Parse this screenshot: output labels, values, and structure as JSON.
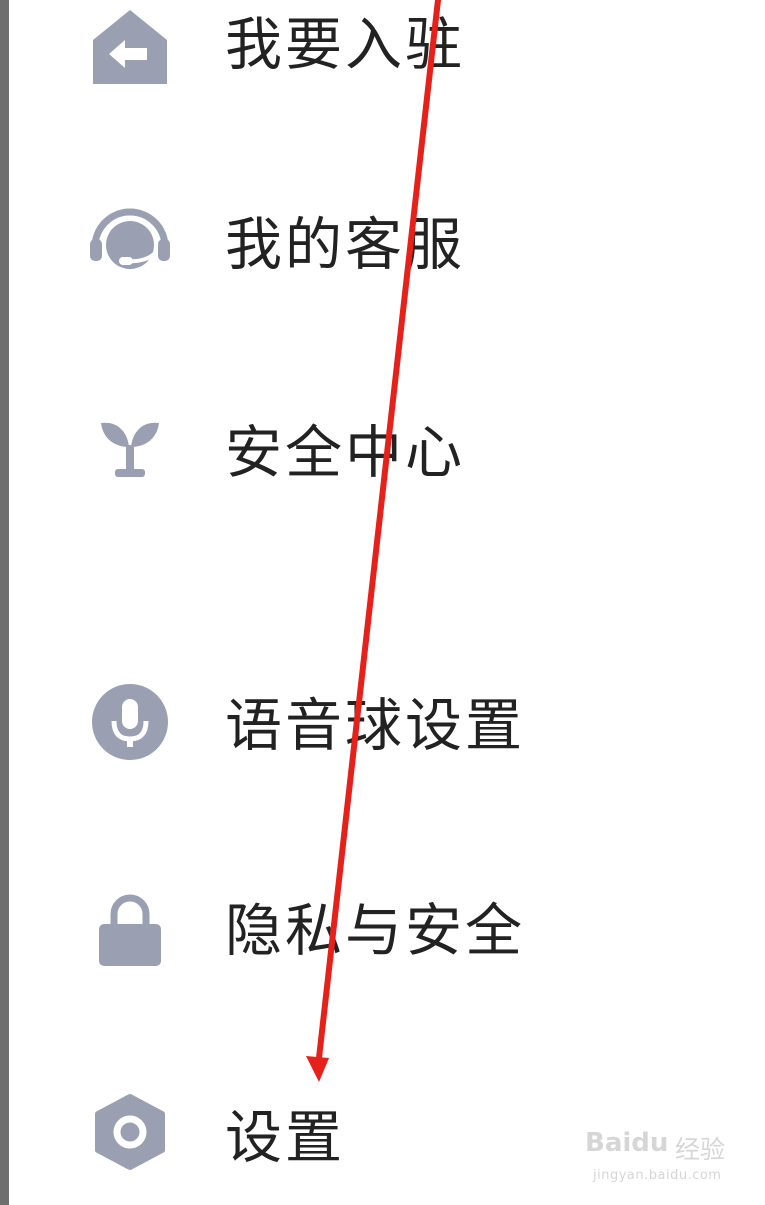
{
  "menu": {
    "items": [
      {
        "label": "我要入驻",
        "icon": "store-entry-icon"
      },
      {
        "label": "我的客服",
        "icon": "customer-service-headset-icon"
      },
      {
        "label": "安全中心",
        "icon": "sprout-icon"
      },
      {
        "label": "语音球设置",
        "icon": "microphone-icon"
      },
      {
        "label": "隐私与安全",
        "icon": "lock-icon"
      },
      {
        "label": "设置",
        "icon": "settings-hexagon-icon"
      }
    ]
  },
  "annotation": {
    "arrow_color": "#e8201a",
    "description_icon": "red-arrow-icon"
  },
  "watermark": {
    "brand": "Bai",
    "brand_suffix": "du",
    "cn_text": "经验",
    "url": "jingyan.baidu.com"
  },
  "colors": {
    "icon_gray": "#9aa0b2",
    "text": "#222222",
    "arrow": "#e8201a",
    "left_edge": "#6e6e6e"
  }
}
